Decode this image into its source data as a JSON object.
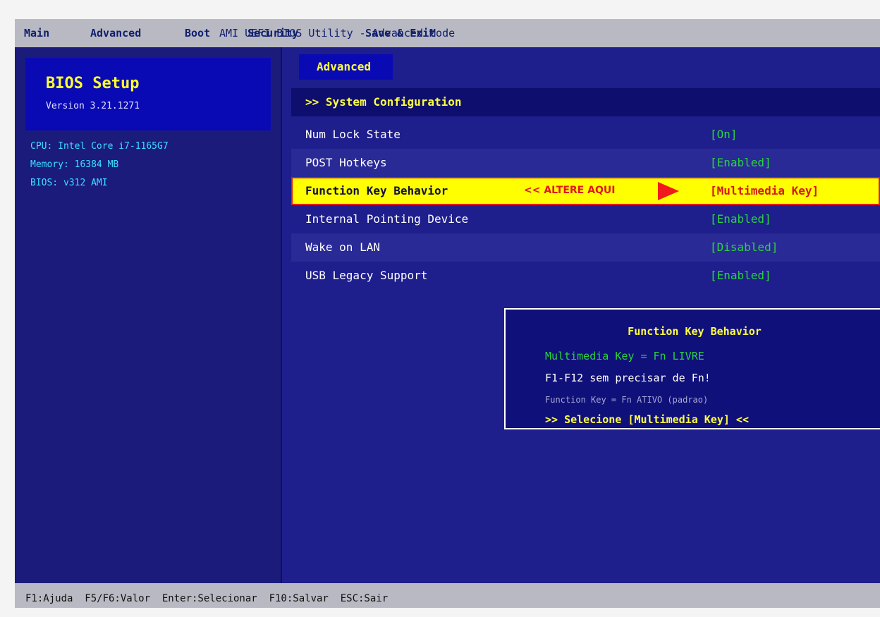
{
  "menu": {
    "items": [
      "Main",
      "Advanced",
      "Boot",
      "Security",
      "Save & Exit"
    ],
    "window_title": "AMI UEFI BIOS Utility - Advanced Mode"
  },
  "sidebar": {
    "logo_title": "BIOS Setup",
    "logo_version": "Version 3.21.1271",
    "cpu": "CPU: Intel Core i7-1165G7",
    "memory": "Memory: 16384 MB",
    "bios": "BIOS: v312 AMI"
  },
  "active_tab": "Advanced",
  "section_header": ">> System Configuration",
  "rows": [
    {
      "label": "Num Lock State",
      "value": "[On]"
    },
    {
      "label": "POST Hotkeys",
      "value": "[Enabled]"
    },
    {
      "label": "Function Key Behavior",
      "value": "[Multimedia Key]",
      "hint": "<<  ALTERE AQUI"
    },
    {
      "label": "Internal Pointing Device",
      "value": "[Enabled]"
    },
    {
      "label": "Wake on LAN",
      "value": "[Disabled]"
    },
    {
      "label": "USB Legacy Support",
      "value": "[Enabled]"
    }
  ],
  "help": {
    "title": "Function Key Behavior",
    "line1": "Multimedia Key = Fn LIVRE",
    "line2": "F1-F12 sem precisar de Fn!",
    "line3": "Function Key = Fn ATIVO (padrao)",
    "line4": ">> Selecione [Multimedia Key] <<"
  },
  "statusbar": "F1:Ajuda  F5/F6:Valor  Enter:Selecionar  F10:Salvar  ESC:Sair",
  "colors": {
    "background": "#1e1e8c",
    "header_bar": "#b9b9c3",
    "selected_row": "#ffff00",
    "selected_border": "#e01818",
    "value_green": "#2bd33e",
    "title_yellow": "#ffff40",
    "info_cyan": "#3be0ff"
  },
  "icons": {
    "hint_arrow": "red-right-triangle-icon"
  }
}
